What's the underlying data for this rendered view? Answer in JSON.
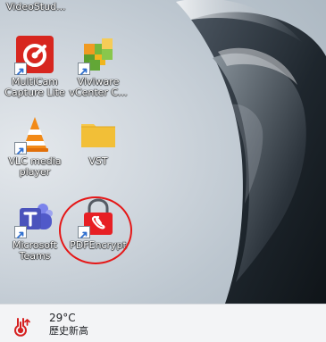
{
  "desktop": {
    "top_labels": {
      "left": "VideoStud...",
      "right": ""
    },
    "shortcuts": [
      {
        "id": "multicam-capture-lite",
        "line1": "MultiCam",
        "line2": "Capture Lite",
        "icon": "multicam-capture-lite-icon"
      },
      {
        "id": "viviware-vcenter",
        "line1": "Viviware",
        "line2": "vCenter C...",
        "icon": "viviware-vcenter-icon"
      },
      {
        "id": "vlc-media-player",
        "line1": "VLC media",
        "line2": "player",
        "icon": "vlc-icon"
      },
      {
        "id": "vst-folder",
        "line1": "VST",
        "line2": "",
        "icon": "folder-icon"
      },
      {
        "id": "microsoft-teams",
        "line1": "Microsoft",
        "line2": "Teams",
        "icon": "teams-icon"
      },
      {
        "id": "pdfencrypt",
        "line1": "PDFEncrypt",
        "line2": "",
        "icon": "pdfencrypt-icon"
      }
    ],
    "highlight_color": "#e51717"
  },
  "taskbar": {
    "weather": {
      "temperature": "29°C",
      "status": "歷史新高"
    }
  }
}
